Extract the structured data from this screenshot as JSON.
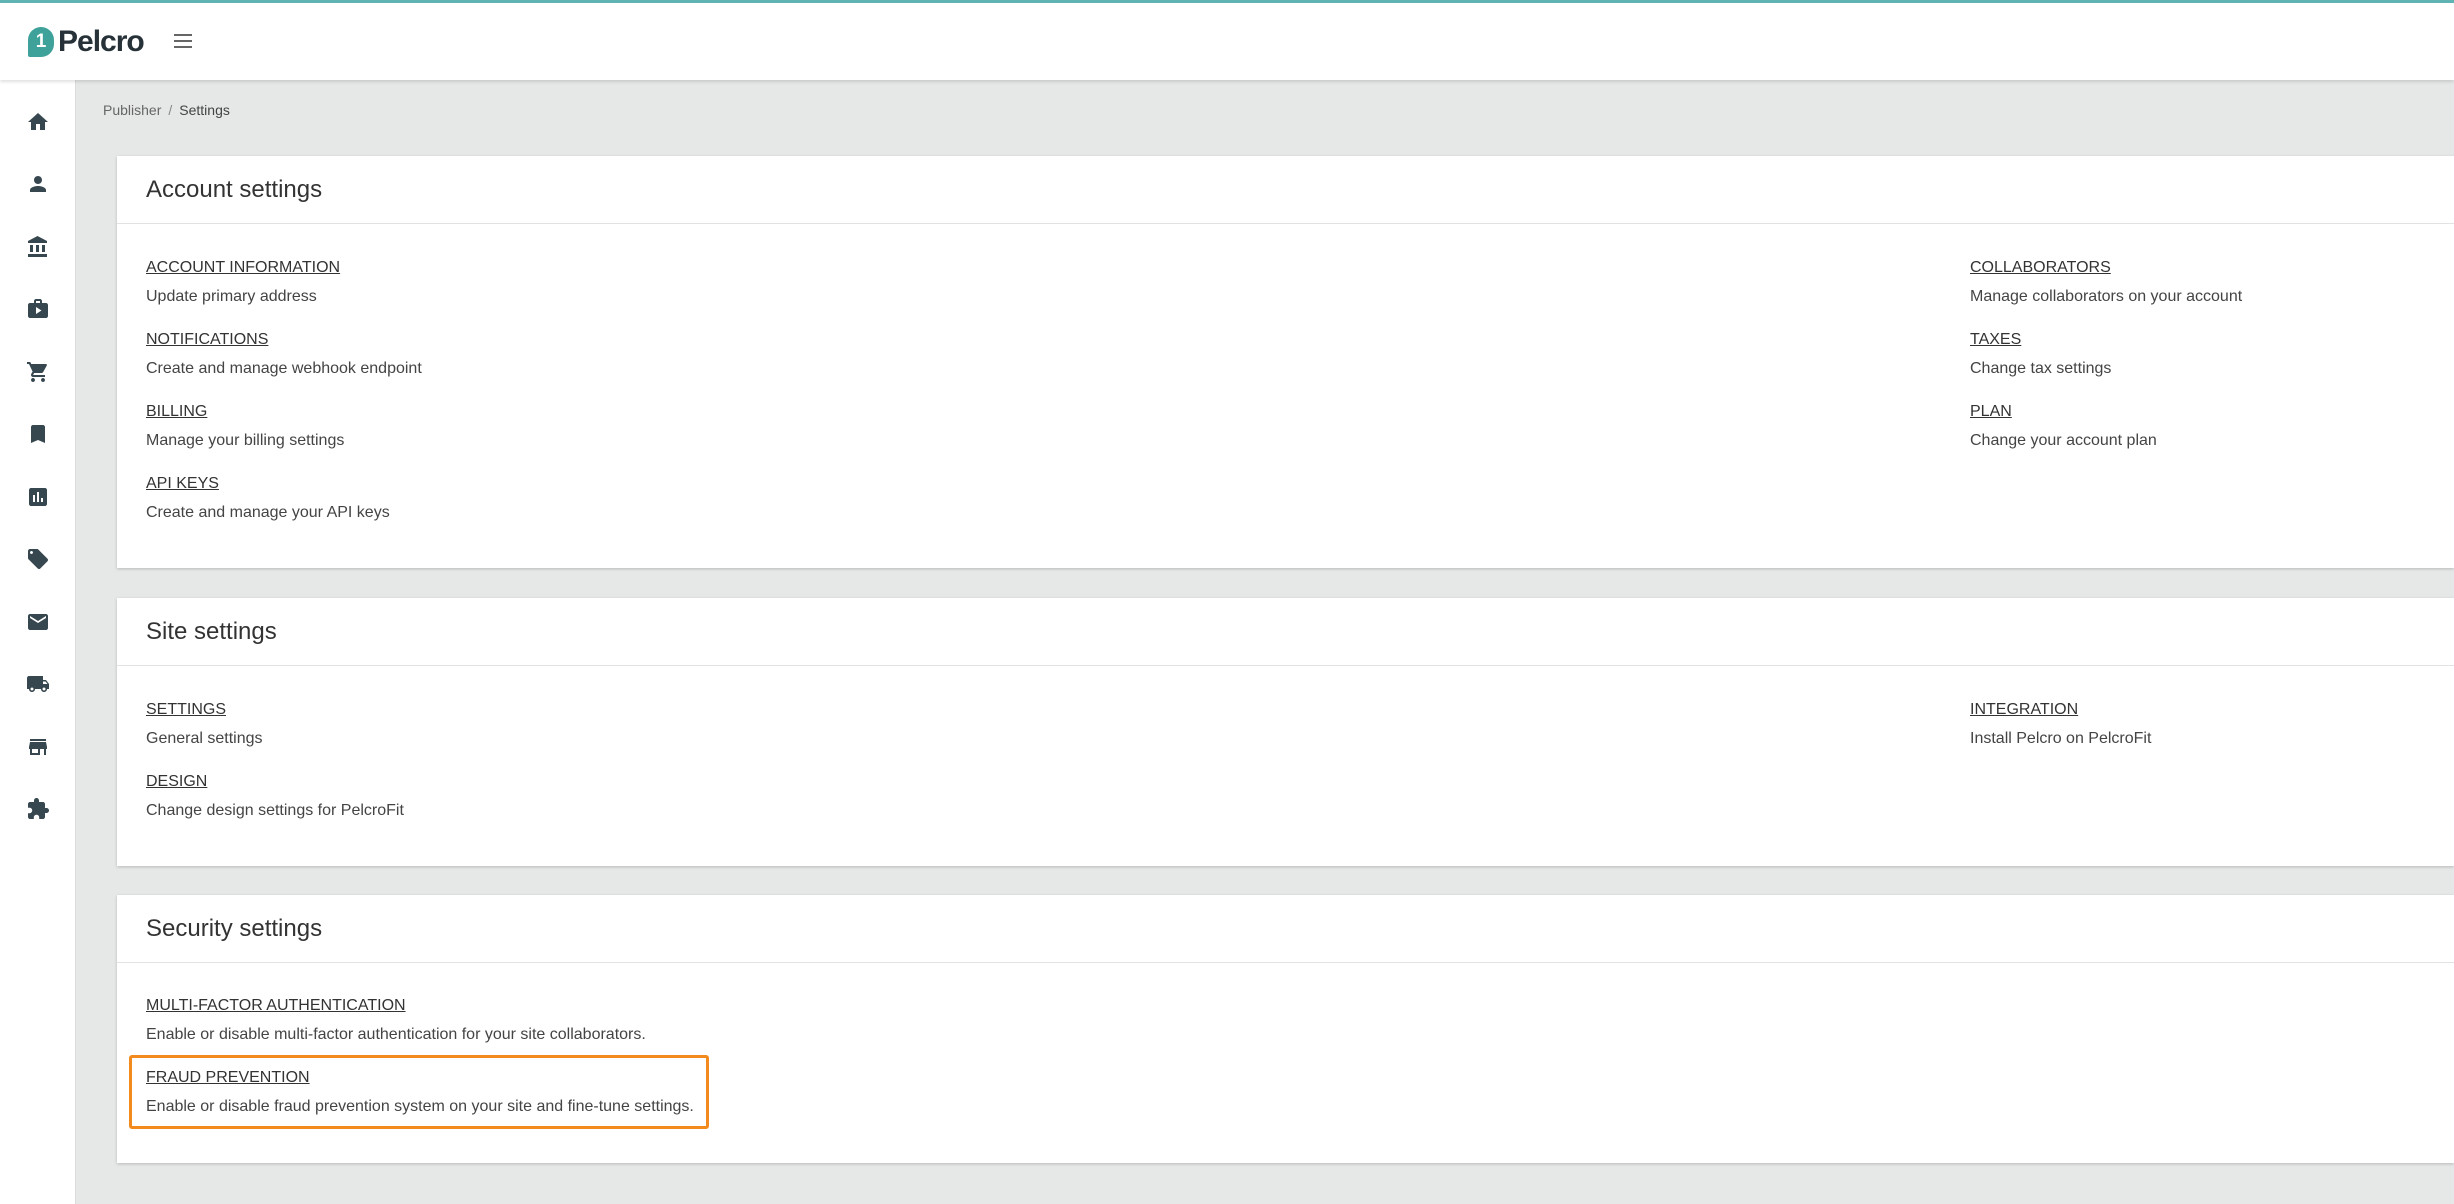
{
  "header": {
    "logo_text": "Pelcro",
    "logo_mark": "1",
    "menu_icon": "hamburger-menu-icon",
    "accent_color": "#5fb3b3"
  },
  "sidebar": {
    "icons": [
      "home-icon",
      "user-icon",
      "bank-icon",
      "briefcase-icon",
      "cart-icon",
      "bookmark-icon",
      "chart-icon",
      "ticket-icon",
      "mail-icon",
      "truck-icon",
      "store-icon",
      "puzzle-icon"
    ]
  },
  "breadcrumb": {
    "parent": "Publisher",
    "separator": "/",
    "current": "Settings"
  },
  "account": {
    "title": "Account settings",
    "items": [
      {
        "label": "ACCOUNT INFORMATION",
        "desc": "Update primary address"
      },
      {
        "label": "NOTIFICATIONS",
        "desc": "Create and manage webhook endpoint"
      },
      {
        "label": "BILLING",
        "desc": "Manage your billing settings"
      },
      {
        "label": "API KEYS",
        "desc": "Create and manage your API keys"
      },
      {
        "label": "COLLABORATORS",
        "desc": "Manage collaborators on your account"
      },
      {
        "label": "TAXES",
        "desc": "Change tax settings"
      },
      {
        "label": "PLAN",
        "desc": "Change your account plan"
      }
    ]
  },
  "site": {
    "title": "Site settings",
    "items": [
      {
        "label": "SETTINGS",
        "desc": "General settings"
      },
      {
        "label": "DESIGN",
        "desc": "Change design settings for PelcroFit"
      },
      {
        "label": "INTEGRATION",
        "desc": "Install Pelcro on PelcroFit"
      }
    ]
  },
  "security": {
    "title": "Security settings",
    "items": [
      {
        "label": "MULTI-FACTOR AUTHENTICATION",
        "desc": "Enable or disable multi-factor authentication for your site collaborators."
      },
      {
        "label": "FRAUD PREVENTION",
        "desc": "Enable or disable fraud prevention system on your site and fine-tune settings."
      }
    ]
  },
  "highlight_color": "#f28a1e"
}
